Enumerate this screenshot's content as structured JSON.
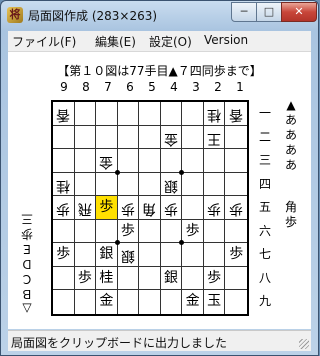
{
  "window": {
    "title": "局面図作成 (283×263)",
    "minimize": "─",
    "maximize": "□",
    "close": "✕"
  },
  "menu": {
    "file": "ファイル(F)",
    "edit": "編集(E)",
    "settings": "設定(O)",
    "version": "Version"
  },
  "board": {
    "header": "【第１０図は77手目▲７四同歩まで】",
    "col_labels": [
      "9",
      "8",
      "7",
      "6",
      "5",
      "4",
      "3",
      "2",
      "1"
    ],
    "row_labels": [
      "一",
      "二",
      "三",
      "四",
      "五",
      "六",
      "七",
      "八",
      "九"
    ],
    "highlight_color": "#ffe000",
    "rows": [
      [
        [
          "香",
          "g"
        ],
        [
          "",
          ""
        ],
        [
          "",
          ""
        ],
        [
          "",
          ""
        ],
        [
          "",
          ""
        ],
        [
          "",
          ""
        ],
        [
          "",
          ""
        ],
        [
          "桂",
          "g"
        ],
        [
          "香",
          "g"
        ]
      ],
      [
        [
          "",
          ""
        ],
        [
          "",
          ""
        ],
        [
          "",
          ""
        ],
        [
          "",
          ""
        ],
        [
          "",
          ""
        ],
        [
          "金",
          "g"
        ],
        [
          "",
          ""
        ],
        [
          "王",
          "g"
        ],
        [
          "",
          ""
        ]
      ],
      [
        [
          "",
          ""
        ],
        [
          "",
          ""
        ],
        [
          "金",
          "g"
        ],
        [
          "",
          ""
        ],
        [
          "",
          ""
        ],
        [
          "",
          ""
        ],
        [
          "",
          ""
        ],
        [
          "",
          ""
        ],
        [
          "",
          ""
        ]
      ],
      [
        [
          "桂",
          "g"
        ],
        [
          "",
          ""
        ],
        [
          "",
          ""
        ],
        [
          "",
          ""
        ],
        [
          "",
          ""
        ],
        [
          "銀",
          "g"
        ],
        [
          "",
          ""
        ],
        [
          "",
          ""
        ],
        [
          "",
          ""
        ]
      ],
      [
        [
          "歩",
          "g"
        ],
        [
          "飛",
          "g"
        ],
        [
          "歩",
          "s",
          "hl"
        ],
        [
          "歩",
          "g"
        ],
        [
          "角",
          "g"
        ],
        [
          "歩",
          "g"
        ],
        [
          "",
          ""
        ],
        [
          "歩",
          "g"
        ],
        [
          "歩",
          "g"
        ]
      ],
      [
        [
          "",
          ""
        ],
        [
          "",
          ""
        ],
        [
          "",
          ""
        ],
        [
          "歩",
          "s"
        ],
        [
          "",
          ""
        ],
        [
          "",
          ""
        ],
        [
          "歩",
          "s"
        ],
        [
          "",
          ""
        ],
        [
          "",
          ""
        ]
      ],
      [
        [
          "歩",
          "s"
        ],
        [
          "",
          ""
        ],
        [
          "銀",
          "s"
        ],
        [
          "銀",
          "g"
        ],
        [
          "",
          ""
        ],
        [
          "",
          ""
        ],
        [
          "",
          ""
        ],
        [
          "",
          ""
        ],
        [
          "歩",
          "s"
        ]
      ],
      [
        [
          "",
          ""
        ],
        [
          "歩",
          "s"
        ],
        [
          "桂",
          "s"
        ],
        [
          "",
          ""
        ],
        [
          "",
          ""
        ],
        [
          "銀",
          "s"
        ],
        [
          "",
          ""
        ],
        [
          "歩",
          "s"
        ],
        [
          "",
          ""
        ]
      ],
      [
        [
          "",
          ""
        ],
        [
          "",
          ""
        ],
        [
          "金",
          "s"
        ],
        [
          "",
          ""
        ],
        [
          "",
          ""
        ],
        [
          "",
          ""
        ],
        [
          "金",
          "s"
        ],
        [
          "玉",
          "s"
        ],
        [
          "",
          ""
        ]
      ],
      [
        [
          "香",
          "s"
        ],
        [
          "",
          ""
        ],
        [
          "",
          ""
        ],
        [
          "",
          ""
        ],
        [
          "飛",
          "s"
        ],
        [
          "",
          ""
        ],
        [
          "",
          ""
        ],
        [
          "桂",
          "s"
        ],
        [
          "香",
          "s"
        ]
      ]
    ]
  },
  "hands": {
    "sente_name": "▲ああああ",
    "sente_pieces": "角歩",
    "gote_name": "△ＢＣＤＥ",
    "gote_pieces": "歩三"
  },
  "status": {
    "message": "局面図をクリップボードに出力しました"
  }
}
